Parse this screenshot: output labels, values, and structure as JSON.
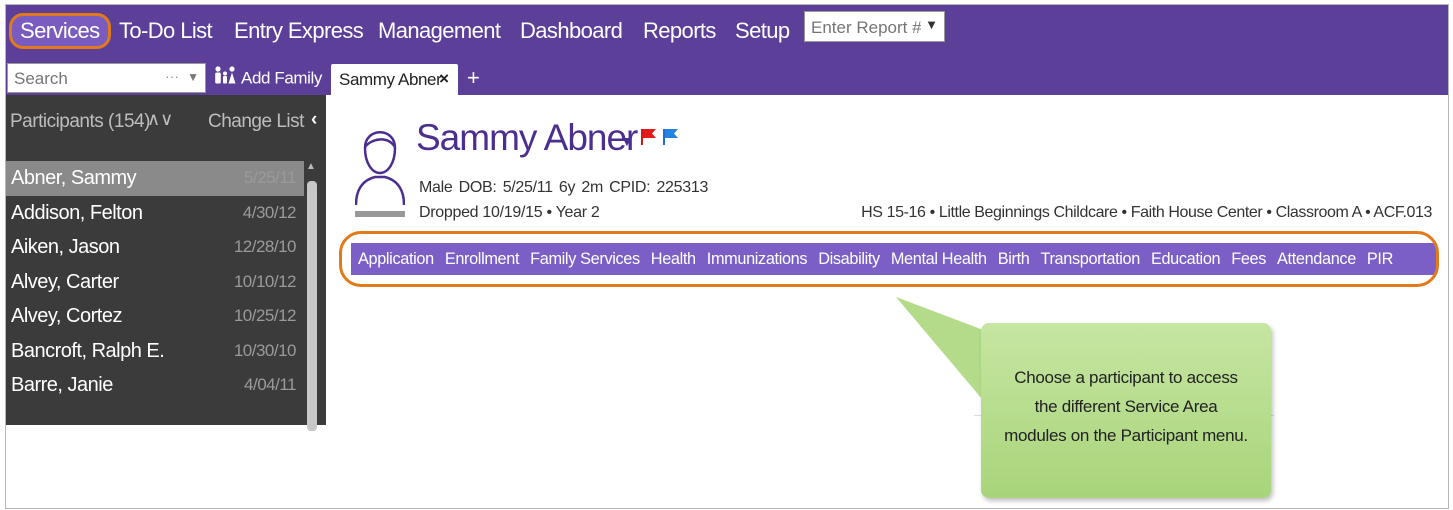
{
  "topnav": {
    "items": [
      "Services",
      "To-Do List",
      "Entry Express",
      "Management",
      "Dashboard",
      "Reports",
      "Setup"
    ],
    "report_placeholder": "Enter Report #"
  },
  "subbar": {
    "search_placeholder": "Search",
    "search_dots": "···",
    "add_family": "Add Family",
    "tab_label": "Sammy Abner",
    "tab_close": "×",
    "tab_add": "+"
  },
  "sidebar": {
    "title": "Participants (154)",
    "sort_arrows": "∧∨",
    "change_list": "Change List",
    "participants": [
      {
        "name": "Abner, Sammy",
        "date": "5/25/11"
      },
      {
        "name": "Addison, Felton",
        "date": "4/30/12"
      },
      {
        "name": "Aiken, Jason",
        "date": "12/28/10"
      },
      {
        "name": "Alvey, Carter",
        "date": "10/10/12"
      },
      {
        "name": "Alvey, Cortez",
        "date": "10/25/12"
      },
      {
        "name": "Bancroft, Ralph E.",
        "date": "10/30/10"
      },
      {
        "name": "Barre, Janie",
        "date": "4/04/11"
      }
    ]
  },
  "participant": {
    "name": "Sammy Abner",
    "info": "Male   DOB: 5/25/11   6y 2m   CPID: 225313",
    "status": "Dropped  10/19/15 • Year 2",
    "program": "HS 15-16 • Little Beginnings Childcare • Faith House Center • Classroom A • ACF.013"
  },
  "service_menu": [
    "Application",
    "Enrollment",
    "Family Services",
    "Health",
    "Immunizations",
    "Disability",
    "Mental Health",
    "Birth",
    "Transportation",
    "Education",
    "Fees",
    "Attendance",
    "PIR"
  ],
  "callout": {
    "line1": "Choose a participant to access",
    "line2": "the different Service Area",
    "line3": "modules on the Participant menu."
  },
  "colors": {
    "nav_purple": "#5b3f99",
    "menu_purple": "#7b5fc6",
    "highlight_orange": "#e07a1a",
    "callout_green": "#b7dd8e"
  }
}
